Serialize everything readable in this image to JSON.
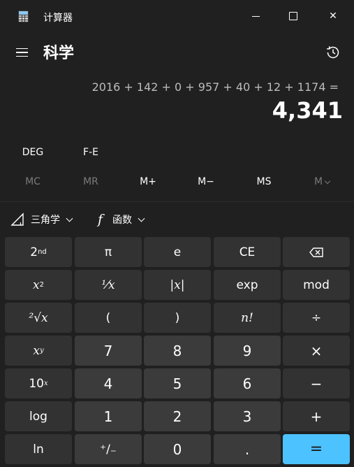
{
  "window": {
    "title": "计算器",
    "minimize_label": "",
    "maximize_label": "",
    "close_label": "✕"
  },
  "header": {
    "mode_title": "科学"
  },
  "display": {
    "expression": "2016 + 142 + 0 + 957 + 40 + 12 + 1174 =",
    "result": "4,341"
  },
  "settings": {
    "angle_unit": "DEG",
    "notation": "F-E"
  },
  "memory": {
    "mc": "MC",
    "mr": "MR",
    "m_plus": "M+",
    "m_minus": "M−",
    "ms": "MS",
    "m_list": "M"
  },
  "functions": {
    "trig_label": "三角学",
    "func_label": "函数"
  },
  "keys": {
    "second": "2",
    "second_sup": "nd",
    "pi": "π",
    "e": "e",
    "ce": "CE",
    "backspace": "⌫",
    "x_sq": "x",
    "x_sq_sup": "2",
    "reciprocal": "⅟x",
    "abs": "|x|",
    "exp": "exp",
    "mod": "mod",
    "root": "²√x",
    "lparen": "(",
    "rparen": ")",
    "factorial": "n!",
    "divide": "÷",
    "x_pow": "x",
    "x_pow_sup": "y",
    "seven": "7",
    "eight": "8",
    "nine": "9",
    "multiply": "×",
    "ten_pow": "10",
    "ten_pow_sup": "x",
    "four": "4",
    "five": "5",
    "six": "6",
    "minus": "−",
    "log": "log",
    "one": "1",
    "two": "2",
    "three": "3",
    "plus": "+",
    "ln": "ln",
    "negate": "⁺∕₋",
    "zero": "0",
    "decimal": ".",
    "equals": "="
  }
}
